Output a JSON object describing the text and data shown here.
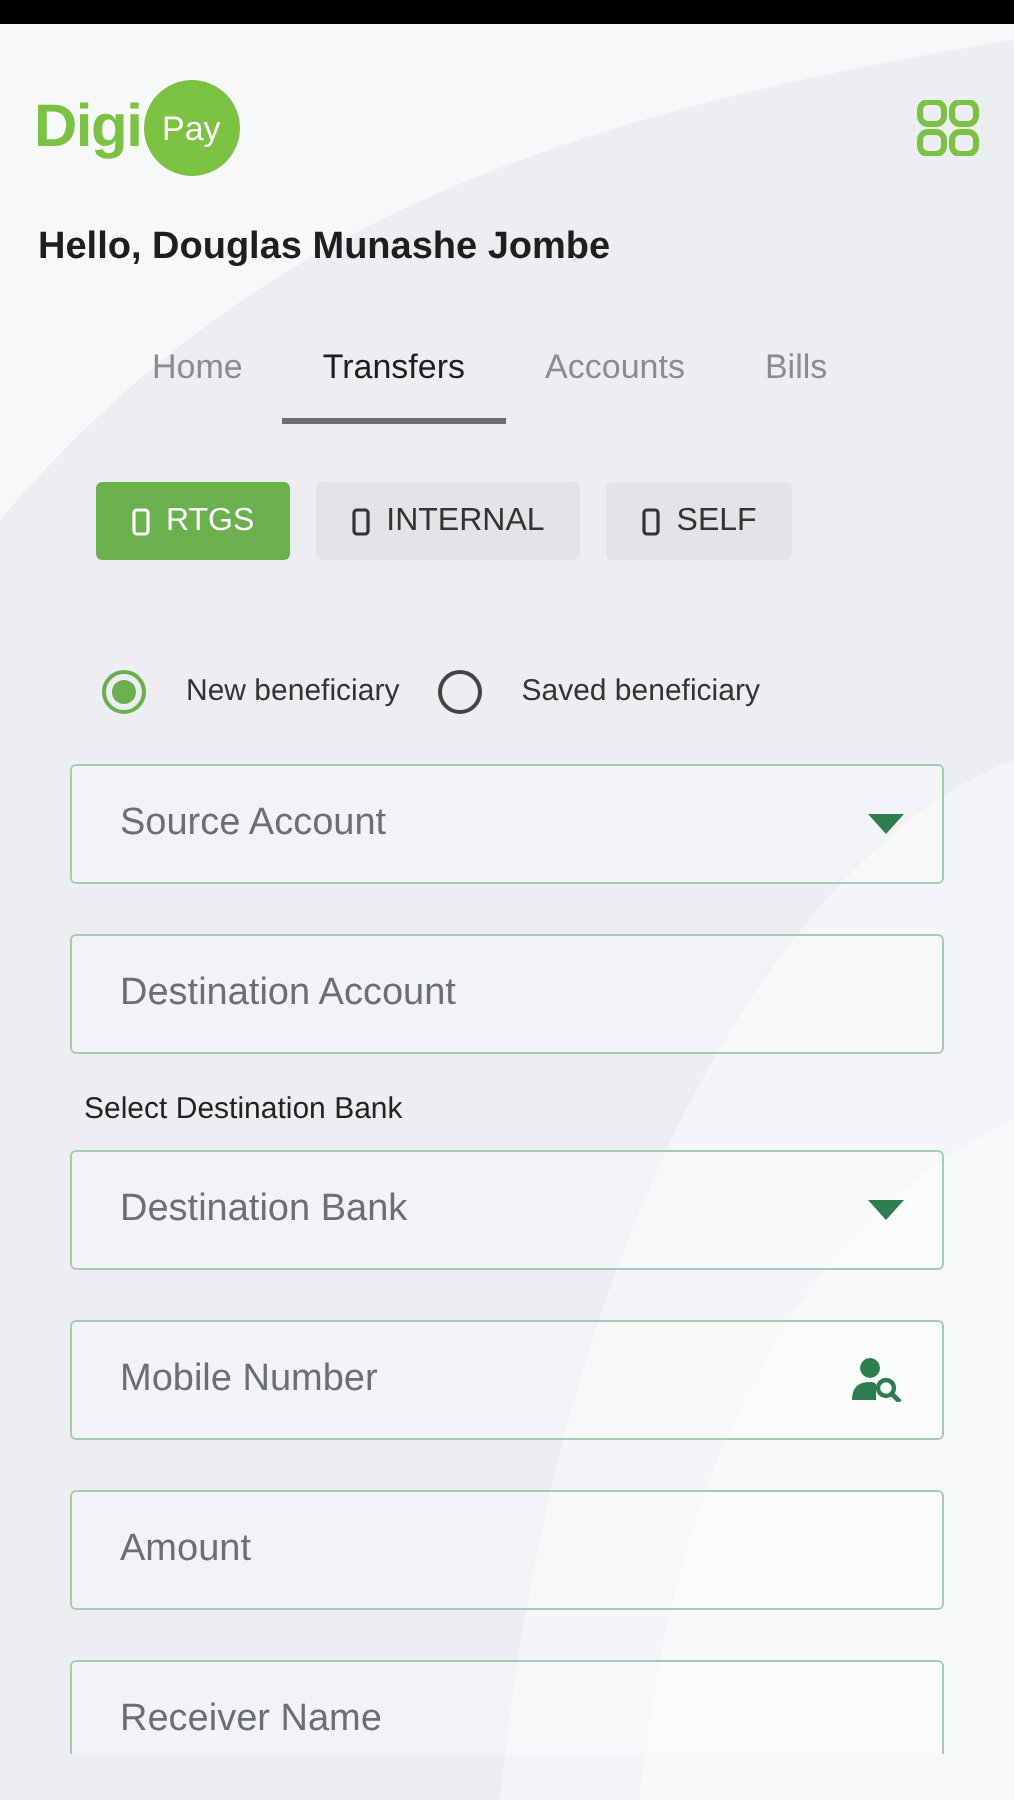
{
  "logo": {
    "part_1": "Digi",
    "part_2": "Pay"
  },
  "greeting": "Hello, Douglas Munashe Jombe",
  "tabs": [
    {
      "label": "Home",
      "selected": false
    },
    {
      "label": "Transfers",
      "selected": true
    },
    {
      "label": "Accounts",
      "selected": false
    },
    {
      "label": "Bills",
      "selected": false
    }
  ],
  "transfer_types": [
    {
      "label": "RTGS",
      "selected": true
    },
    {
      "label": "INTERNAL",
      "selected": false
    },
    {
      "label": "SELF",
      "selected": false
    }
  ],
  "beneficiary_options": [
    {
      "label": "New beneficiary",
      "selected": true
    },
    {
      "label": "Saved beneficiary",
      "selected": false
    }
  ],
  "fields": [
    {
      "kind": "select",
      "placeholder": "Source Account"
    },
    {
      "kind": "text",
      "placeholder": "Destination Account"
    },
    {
      "kind": "select",
      "label": "Select Destination Bank",
      "placeholder": "Destination Bank"
    },
    {
      "kind": "contact",
      "placeholder": "Mobile Number"
    },
    {
      "kind": "text",
      "placeholder": "Amount"
    },
    {
      "kind": "text",
      "placeholder": "Receiver Name"
    }
  ]
}
